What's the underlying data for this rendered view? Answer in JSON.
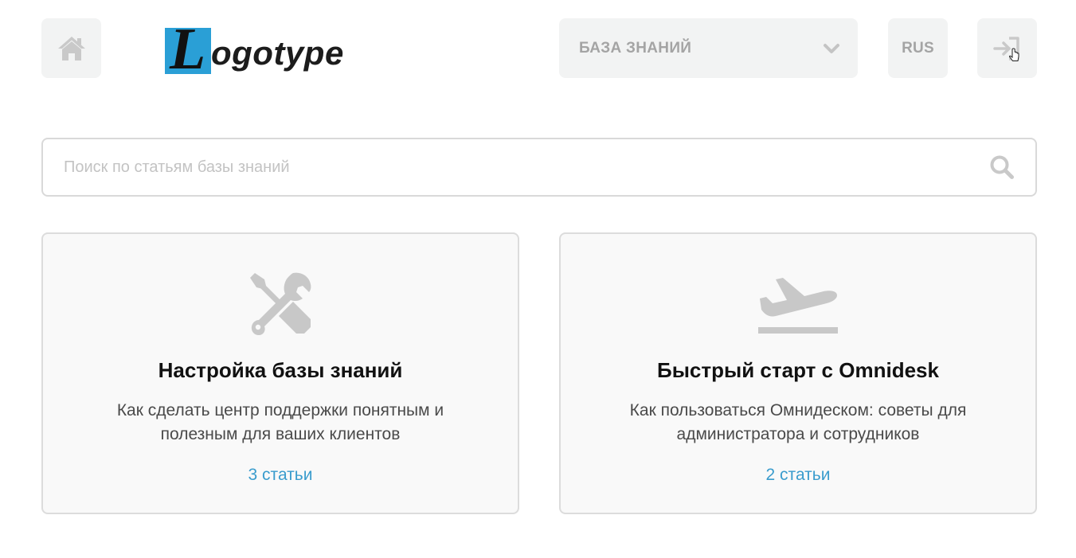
{
  "header": {
    "home_icon": "home-icon",
    "logo": {
      "letter": "L",
      "text": "ogotype",
      "box_color": "#2a9fd6"
    },
    "section_select": {
      "value": "БАЗА ЗНАНИЙ",
      "icon": "chevron-down-icon"
    },
    "language": "RUS",
    "login_icon": "sign-in-icon"
  },
  "search": {
    "placeholder": "Поиск по статьям базы знаний",
    "value": "",
    "icon": "search-icon"
  },
  "categories": [
    {
      "icon": "tools-icon",
      "title": "Настройка базы знаний",
      "description": "Как сделать центр поддержки понятным и полезным для ваших клиентов",
      "count": "3 статьи"
    },
    {
      "icon": "plane-takeoff-icon",
      "title": "Быстрый старт с Omnidesk",
      "description": "Как пользоваться Омнидеском: советы для администратора и сотрудников",
      "count": "2 статьи"
    }
  ],
  "colors": {
    "accent": "#3a9ccd",
    "button_bg": "#f2f3f3",
    "icon_gray": "#c8c8c8",
    "card_bg": "#f9f9f9"
  }
}
